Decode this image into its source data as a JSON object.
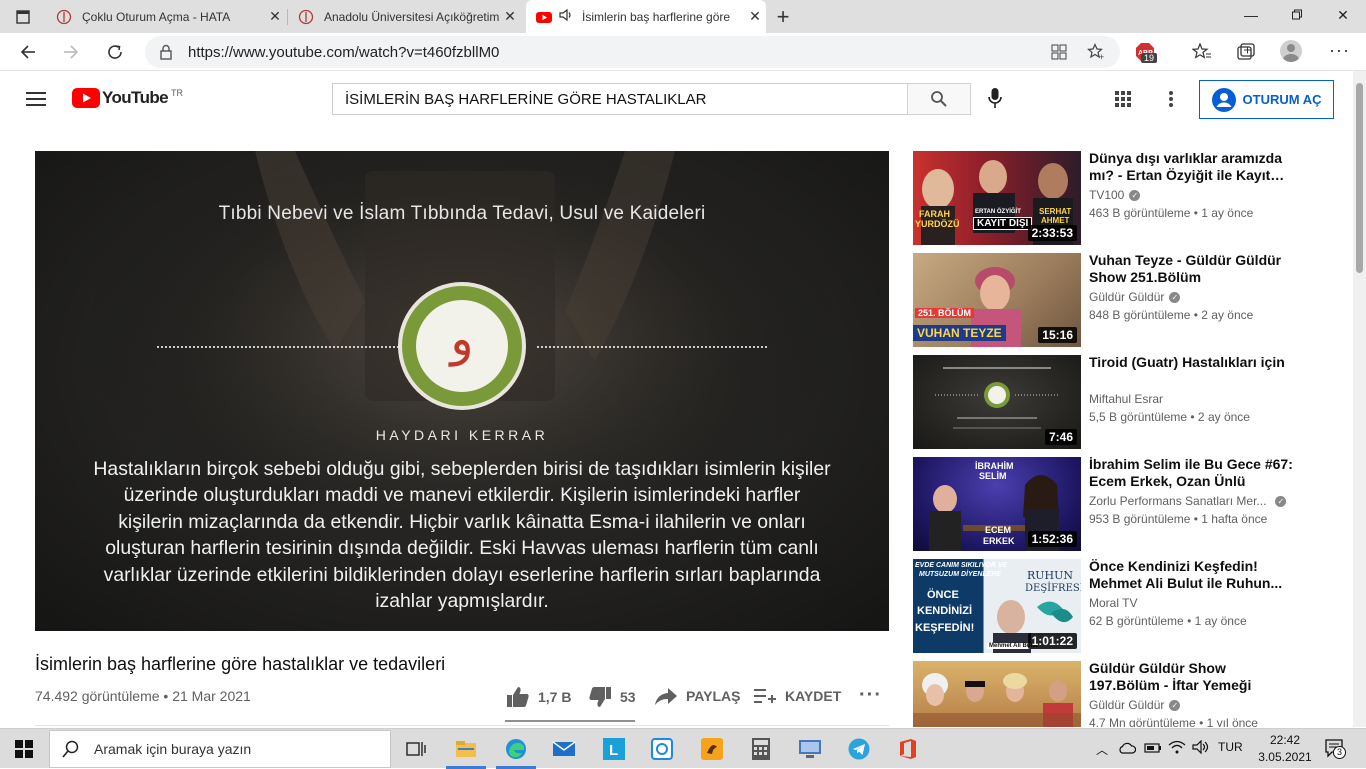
{
  "browser": {
    "tabs": [
      {
        "title": "Çoklu Oturum Açma - HATA",
        "icon": "anadolu-logo-icon"
      },
      {
        "title": "Anadolu Üniversitesi Açıköğretim",
        "icon": "anadolu-logo-icon"
      },
      {
        "title": "İsimlerin baş harflerine göre",
        "icon": "youtube-icon",
        "active": true
      }
    ],
    "url": "https://www.youtube.com/watch?v=t460fzbllM0",
    "extension_badge": "19"
  },
  "youtube": {
    "logo_text": "YouTube",
    "region": "TR",
    "search_value": "İSİMLERİN BAŞ HARFLERİNE GÖRE HASTALIKLAR",
    "signin_label": "OTURUM AÇ"
  },
  "video": {
    "overlay_heading": "Tıbbi Nebevi ve İslam Tıbbında Tedavi, Usul ve Kaideleri",
    "overlay_logo_letter": "و",
    "overlay_brand": "HAYDARI KERRAR",
    "overlay_paragraph": "Hastalıkların birçok sebebi olduğu gibi, sebeplerden birisi de taşıdıkları isimlerin kişiler üzerinde oluşturdukları maddi ve manevi etkilerdir. Kişilerin isimlerindeki harfler kişilerin mizaçlarında da etkendir. Hiçbir varlık kâinatta Esma-i ilahilerin ve onları oluşturan harflerin tesirinin dışında değildir. Eski Havvas uleması harflerin tüm canlı varlıklar üzerinde etkilerini bildiklerinden dolayı eserlerine harflerin sırları baplarında izahlar yapmışlardır.",
    "title": "İsimlerin baş harflerine göre hastalıklar ve tedavileri",
    "meta": "74.492 görüntüleme • 21 Mar 2021",
    "likes": "1,7 B",
    "dislikes": "53",
    "share_label": "PAYLAŞ",
    "save_label": "KAYDET"
  },
  "recommendations": [
    {
      "title": "Dünya dışı varlıklar aramızda mı? - Ertan Özyiğit ile Kayıt Dışı...",
      "channel": "TV100",
      "verified": true,
      "meta": "463 B görüntüleme • 1 ay önce",
      "duration": "2:33:53",
      "thumb_text": [
        "FARAH",
        "YURDÖZÜ",
        "ERTAN ÖZYİĞİT",
        "KAYIT DIŞI",
        "SERHAT",
        "AHMET"
      ]
    },
    {
      "title": "Vuhan Teyze - Güldür Güldür Show 251.Bölüm",
      "channel": "Güldür Güldür",
      "verified": true,
      "meta": "848 B görüntüleme • 2 ay önce",
      "duration": "15:16",
      "thumb_text": [
        "251. BÖLÜM",
        "VUHAN TEYZE"
      ]
    },
    {
      "title": "Tiroid (Guatr) Hastalıkları için",
      "channel": "Miftahul Esrar",
      "verified": false,
      "meta": "5,5 B görüntüleme • 2 ay önce",
      "duration": "7:46",
      "thumb_text": []
    },
    {
      "title": "İbrahim Selim ile Bu Gece #67: Ecem Erkek, Ozan Ünlü",
      "channel": "Zorlu Performans Sanatları Mer...",
      "verified": true,
      "meta": "953 B görüntüleme • 1 hafta önce",
      "duration": "1:52:36",
      "thumb_text": [
        "İBRAHİM",
        "SELİM",
        "ECEM",
        "ERKEK"
      ]
    },
    {
      "title": "Önce Kendinizi Keşfedin! Mehmet Ali Bulut ile Ruhun...",
      "channel": "Moral TV",
      "verified": false,
      "meta": "62 B görüntüleme • 1 ay önce",
      "duration": "1:01:22",
      "thumb_text": [
        "EVDE CANIM SIKILIYOR VE",
        "MUTSUZUM DİYENLERE",
        "ÖNCE",
        "KENDİNİZİ",
        "KEŞFEDİN!",
        "RUHUN",
        "DEŞİFRESİ",
        "Mehmet Ali Bulut"
      ]
    },
    {
      "title": "Güldür Güldür Show 197.Bölüm - İftar Yemeği",
      "channel": "Güldür Güldür",
      "verified": true,
      "meta": "4,7 Mn görüntüleme • 1 yıl önce",
      "duration": "",
      "thumb_text": []
    }
  ],
  "taskbar": {
    "search_placeholder": "Aramak için buraya yazın",
    "language": "TUR",
    "time": "22:42",
    "date": "3.05.2021",
    "notifications": "3"
  },
  "colors": {
    "youtube_red": "#ff0000",
    "signin_blue": "#065fd4",
    "logo_green": "#7a9a3a"
  }
}
